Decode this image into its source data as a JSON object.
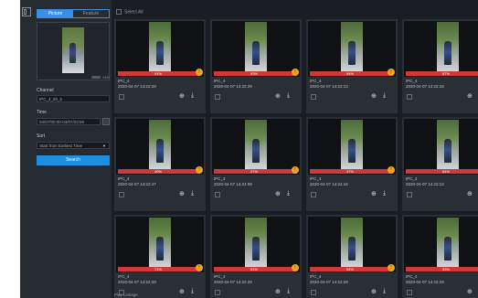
{
  "tabs": [
    "Picture",
    "Feature"
  ],
  "preview": {
    "similarity": "24%"
  },
  "channel": {
    "label": "Channel",
    "value": "IPC_4_5h_5"
  },
  "time": {
    "label": "Time",
    "value": "04/07/00:00-04/07/23:59"
  },
  "sort": {
    "label": "Sort",
    "value": "Start from Earliest Time"
  },
  "search_label": "Search",
  "select_all": "Select All",
  "cards": [
    {
      "pct": "94%",
      "channel": "IPC_4",
      "time": "2020-04-07 14:22:29"
    },
    {
      "pct": "93%",
      "channel": "IPC_4",
      "time": "2020-04-07 14:22:29"
    },
    {
      "pct": "94%",
      "channel": "IPC_4",
      "time": "2020-04-07 14:22:13"
    },
    {
      "pct": "87%",
      "channel": "IPC_4",
      "time": "2020-04-07 14:22:16"
    },
    {
      "pct": "49%",
      "channel": "IPC_4",
      "time": "2020-04-07 14:22:47"
    },
    {
      "pct": "27%",
      "channel": "IPC_4",
      "time": "2020-04-07 14:24:09"
    },
    {
      "pct": "37%",
      "channel": "IPC_4",
      "time": "2020-04-07 14:24:44"
    },
    {
      "pct": "84%",
      "channel": "IPC_4",
      "time": "2020-04-07 14:22:13"
    },
    {
      "pct": "71%",
      "channel": "IPC_4",
      "time": "2020-04-07 14:22:29"
    },
    {
      "pct": "91%",
      "channel": "IPC_4",
      "time": "2020-04-07 14:22:29"
    },
    {
      "pct": "94%",
      "channel": "IPC_4",
      "time": "2020-04-07 14:22:29"
    },
    {
      "pct": "93%",
      "channel": "IPC_4",
      "time": "2020-04-07 14:22:29"
    }
  ],
  "bottom_text": "Play Linkage",
  "colors": {
    "accent": "#1e8fe0",
    "bar": "#d2383b",
    "badge": "#f2a51a"
  }
}
